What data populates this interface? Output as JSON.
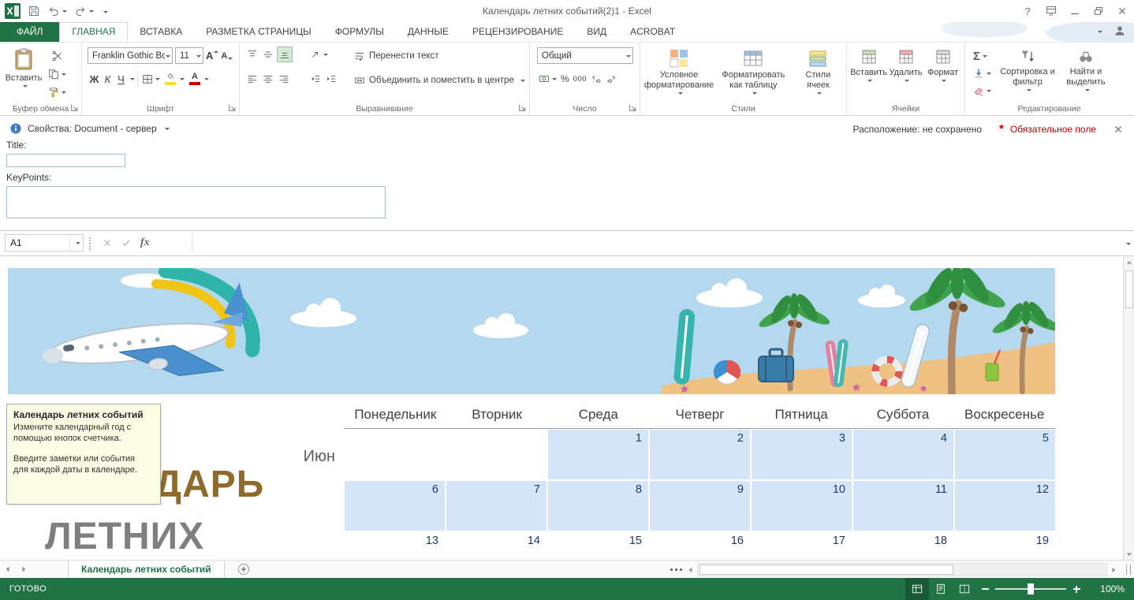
{
  "window": {
    "title": "Календарь летних событий(2)1 - Excel",
    "help_glyph": "?"
  },
  "ribbon": {
    "tabs": [
      {
        "id": "file",
        "label": "ФАЙЛ"
      },
      {
        "id": "home",
        "label": "ГЛАВНАЯ",
        "active": true
      },
      {
        "id": "insert",
        "label": "ВСТАВКА"
      },
      {
        "id": "page-layout",
        "label": "РАЗМЕТКА СТРАНИЦЫ"
      },
      {
        "id": "formulas",
        "label": "ФОРМУЛЫ"
      },
      {
        "id": "data",
        "label": "ДАННЫЕ"
      },
      {
        "id": "review",
        "label": "РЕЦЕНЗИРОВАНИЕ"
      },
      {
        "id": "view",
        "label": "ВИД"
      },
      {
        "id": "acrobat",
        "label": "ACROBAT"
      }
    ],
    "clipboard": {
      "group": "Буфер обмена",
      "paste": "Вставить"
    },
    "font": {
      "group": "Шрифт",
      "name": "Franklin Gothic Bc",
      "size": "11",
      "bold": "Ж",
      "italic": "К",
      "underline": "Ч",
      "grow": "А",
      "shrink": "А",
      "color_letter": "А"
    },
    "alignment": {
      "group": "Выравнивание",
      "wrap": "Перенести текст",
      "merge": "Объединить и поместить в центре"
    },
    "number": {
      "group": "Число",
      "format": "Общий",
      "percent": "%",
      "thousands": "000"
    },
    "styles": {
      "group": "Стили",
      "conditional": "Условное форматирование",
      "as_table": "Форматировать как таблицу",
      "cell_styles": "Стили ячеек"
    },
    "cells": {
      "group": "Ячейки",
      "insert": "Вставить",
      "delete": "Удалить",
      "format": "Формат"
    },
    "editing": {
      "group": "Редактирование",
      "autosum": "Σ",
      "sort": "Сортировка и фильтр",
      "find": "Найти и выделить"
    }
  },
  "doc_panel": {
    "header": "Свойства: Document - сервер",
    "location": "Расположение: не сохранено",
    "required_star": "*",
    "required_text": "Обязательное поле",
    "title_label": "Title:",
    "title_value": "",
    "keypoints_label": "KeyPoints:",
    "keypoints_value": ""
  },
  "formula_bar": {
    "name_box": "A1",
    "fx": "fx",
    "value": ""
  },
  "sheet": {
    "note": {
      "title": "Календарь летних событий",
      "lines": [
        "Измените календарный год с",
        "помощью кнопок счетчика.",
        "",
        "Введите заметки или события",
        "для каждой даты в календаре."
      ]
    },
    "big_title_line1": "КАЛЕНДАРЬ",
    "big_title_line2": "ЛЕТНИХ",
    "month": "Июн",
    "day_headers": [
      "Понедельник",
      "Вторник",
      "Среда",
      "Четверг",
      "Пятница",
      "Суббота",
      "Воскресенье"
    ],
    "weeks": [
      {
        "cells": [
          {
            "d": "",
            "s": false
          },
          {
            "d": "",
            "s": false
          },
          {
            "d": "1",
            "s": true
          },
          {
            "d": "2",
            "s": true
          },
          {
            "d": "3",
            "s": true
          },
          {
            "d": "4",
            "s": true
          },
          {
            "d": "5",
            "s": true
          }
        ]
      },
      {
        "cells": [
          {
            "d": "6",
            "s": true
          },
          {
            "d": "7",
            "s": true
          },
          {
            "d": "8",
            "s": true
          },
          {
            "d": "9",
            "s": true
          },
          {
            "d": "10",
            "s": true
          },
          {
            "d": "11",
            "s": true
          },
          {
            "d": "12",
            "s": true
          }
        ]
      },
      {
        "cells": [
          {
            "d": "13",
            "s": false
          },
          {
            "d": "14",
            "s": false
          },
          {
            "d": "15",
            "s": false
          },
          {
            "d": "16",
            "s": false
          },
          {
            "d": "17",
            "s": false
          },
          {
            "d": "18",
            "s": false
          },
          {
            "d": "19",
            "s": false
          }
        ]
      }
    ]
  },
  "tabs_bar": {
    "sheet_tab": "Календарь летних событий"
  },
  "status_bar": {
    "mode": "ГОТОВО",
    "zoom": "100%"
  },
  "colors": {
    "excel_green": "#217346",
    "cell_blue": "#D3E5F6",
    "banner_sky": "#B4D8EE",
    "sand": "#EFC183",
    "title_brown": "#8E6B2D",
    "title_gray": "#7F7F7F",
    "date_navy": "#1F3A63",
    "required_red": "#C00000"
  }
}
